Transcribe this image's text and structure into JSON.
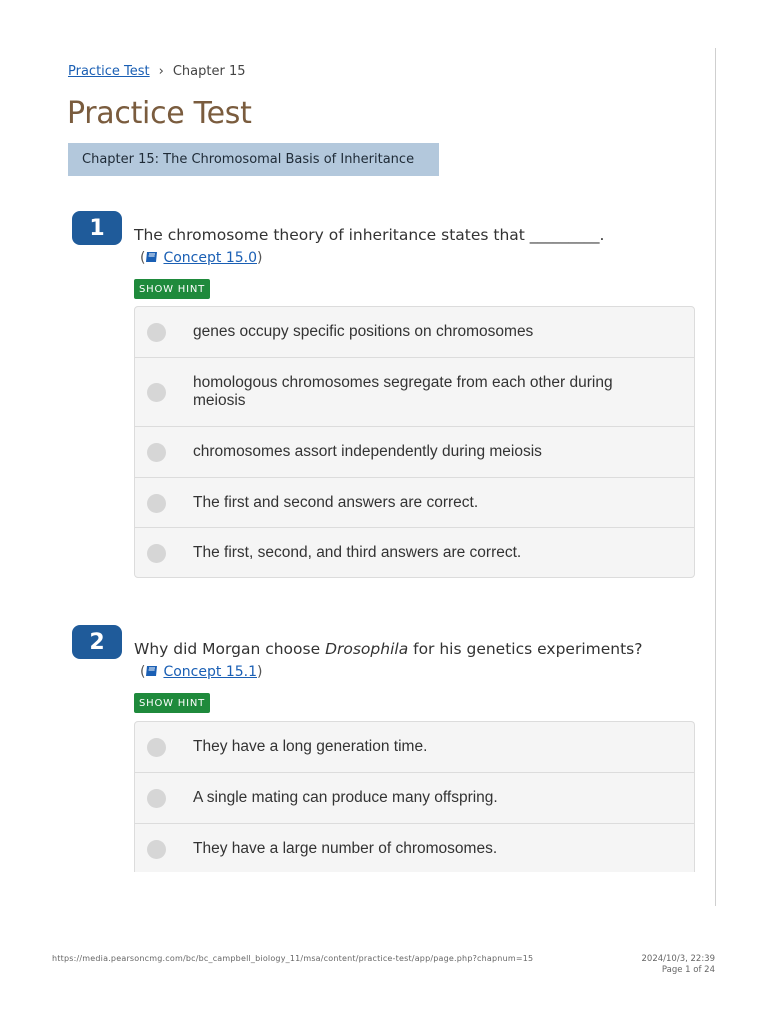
{
  "breadcrumb": {
    "link": "Practice Test",
    "current": "Chapter 15"
  },
  "page_title": "Practice Test",
  "chapter_banner": "Chapter 15: The Chromosomal Basis of Inheritance",
  "questions": [
    {
      "number": "1",
      "text": "The chromosome theory of inheritance states that _________.",
      "concept": "Concept 15.0",
      "hint_label": "SHOW HINT",
      "answers": [
        "genes occupy specific positions on chromosomes",
        "homologous chromosomes segregate from each other during meiosis",
        "chromosomes assort independently during meiosis",
        "The first and second answers are correct.",
        "The first, second, and third answers are correct."
      ]
    },
    {
      "number": "2",
      "text_before": "Why did Morgan choose ",
      "text_italic": "Drosophila",
      "text_after": " for his genetics experiments?",
      "concept": "Concept 15.1",
      "hint_label": "SHOW HINT",
      "answers": [
        "They have a long generation time.",
        "A single mating can produce many offspring.",
        "They have a large number of chromosomes."
      ]
    }
  ],
  "footer": {
    "url": "https://media.pearsoncmg.com/bc/bc_campbell_biology_11/msa/content/practice-test/app/page.php?chapnum=15",
    "timestamp": "2024/10/3, 22:39",
    "page": "Page 1 of 24"
  },
  "colors": {
    "title": "#7a5c3e",
    "banner": "#b3c8dc",
    "number_badge": "#1f5b9a",
    "hint": "#1f8a3c",
    "link": "#1a5fb4"
  }
}
